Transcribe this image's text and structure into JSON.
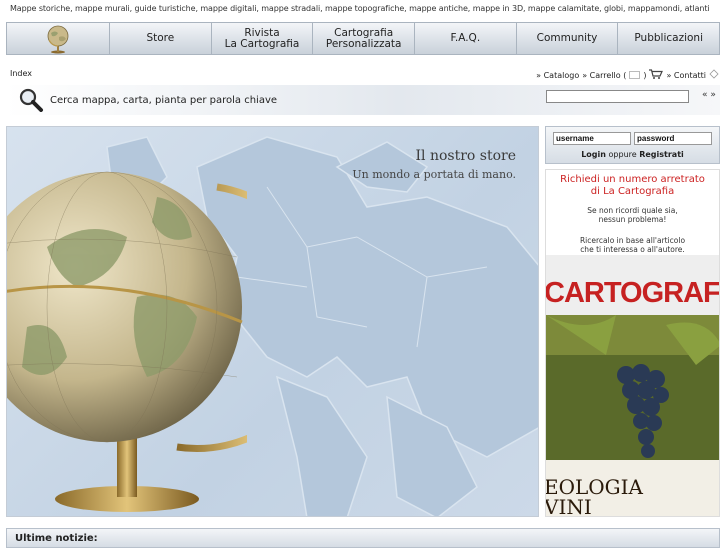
{
  "tagline": "Mappe storiche, mappe murali, guide turistiche, mappe digitali, mappe stradali, mappe topografiche, mappe antiche, mappe in 3D, mappe calamitate, globi, mappamondi, atlanti",
  "nav": {
    "items": [
      "Store",
      "Rivista\nLa Cartografia",
      "Cartografia\nPersonalizzata",
      "F.A.Q.",
      "Community",
      "Pubblicazioni"
    ]
  },
  "breadcrumb": "Index",
  "toplinks": {
    "catalogo": "» Catalogo",
    "carrello": "» Carrello (",
    "carrello_close": ")",
    "contatti": "» Contatti"
  },
  "search": {
    "label": "Cerca mappa, carta, pianta per parola chiave",
    "value": "",
    "go": "« »"
  },
  "hero": {
    "title": "Il nostro store",
    "subtitle": "Un mondo a portata di mano."
  },
  "login": {
    "username_value": "username",
    "password_value": "password",
    "login_link": "Login",
    "oppure": "oppure",
    "register_link": "Registrati"
  },
  "promo": {
    "title": "Richiedi un numero arretrato\ndi La Cartografia",
    "line1": "Se non ricordi quale sia,\nnessun problema!",
    "line2": "Ricercalo in base all'articolo\nche ti interessa o all'autore.",
    "magazine_title": "CARTOGRAFIA",
    "magazine_headline": "EOLOGIA\nVINI"
  },
  "news": {
    "label": "Ultime notizie:"
  },
  "colors": {
    "promo_red": "#cc2222",
    "nav_border": "#aab4bf",
    "hero_bg": "#c9d7e6"
  }
}
